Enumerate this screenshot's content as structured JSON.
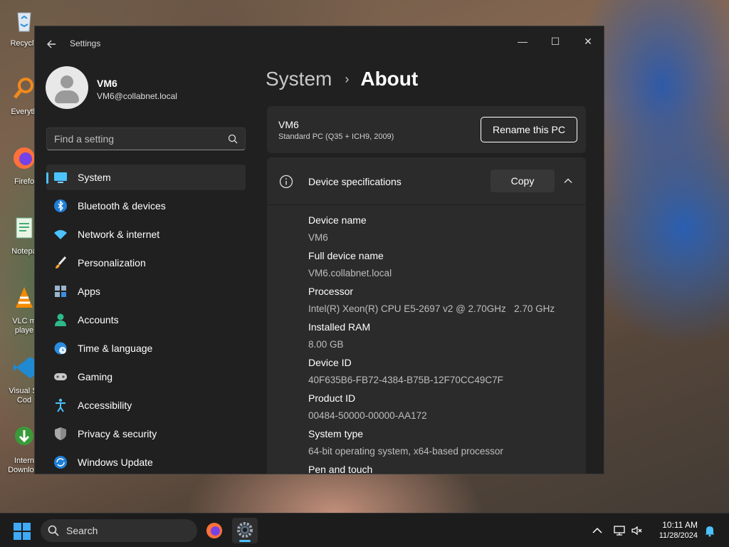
{
  "desktop": {
    "icons": [
      {
        "label": "Recycle",
        "icon": "recycle-bin-icon"
      },
      {
        "label": "Everyth",
        "icon": "everything-search-icon"
      },
      {
        "label": "Firefo",
        "icon": "firefox-icon"
      },
      {
        "label": "Notepa",
        "icon": "notepad-icon"
      },
      {
        "label": "VLC m\nplaye",
        "icon": "vlc-icon"
      },
      {
        "label": "Visual St\nCod",
        "icon": "vscode-icon"
      },
      {
        "label": "Intern\nDownlo...",
        "icon": "internet-download-manager-icon"
      }
    ]
  },
  "window": {
    "title": "Settings",
    "controls": {
      "minimize": "—",
      "maximize": "☐",
      "close": "✕"
    }
  },
  "user": {
    "name": "VM6",
    "email": "VM6@collabnet.local"
  },
  "search": {
    "placeholder": "Find a setting"
  },
  "sidebar": {
    "items": [
      {
        "label": "System",
        "icon": "system-icon",
        "selected": true
      },
      {
        "label": "Bluetooth & devices",
        "icon": "bluetooth-icon"
      },
      {
        "label": "Network & internet",
        "icon": "wifi-icon"
      },
      {
        "label": "Personalization",
        "icon": "brush-icon"
      },
      {
        "label": "Apps",
        "icon": "apps-icon"
      },
      {
        "label": "Accounts",
        "icon": "accounts-icon"
      },
      {
        "label": "Time & language",
        "icon": "globe-clock-icon"
      },
      {
        "label": "Gaming",
        "icon": "gamepad-icon"
      },
      {
        "label": "Accessibility",
        "icon": "accessibility-icon"
      },
      {
        "label": "Privacy & security",
        "icon": "shield-icon"
      },
      {
        "label": "Windows Update",
        "icon": "update-icon"
      }
    ]
  },
  "main": {
    "breadcrumb": {
      "parent": "System",
      "separator": "›",
      "current": "About"
    },
    "pc_card": {
      "name": "VM6",
      "model": "Standard PC (Q35 + ICH9, 2009)",
      "rename_label": "Rename this PC"
    },
    "device_specs": {
      "title": "Device specifications",
      "copy_label": "Copy",
      "items": [
        {
          "label": "Device name",
          "value": "VM6"
        },
        {
          "label": "Full device name",
          "value": "VM6.collabnet.local"
        },
        {
          "label": "Processor",
          "value": "Intel(R) Xeon(R) CPU E5-2697 v2 @ 2.70GHz   2.70 GHz"
        },
        {
          "label": "Installed RAM",
          "value": "8.00 GB"
        },
        {
          "label": "Device ID",
          "value": "40F635B6-FB72-4384-B75B-12F70CC49C7F"
        },
        {
          "label": "Product ID",
          "value": "00484-50000-00000-AA172"
        },
        {
          "label": "System type",
          "value": "64-bit operating system, x64-based processor"
        },
        {
          "label": "Pen and touch",
          "value": ""
        }
      ]
    }
  },
  "taskbar": {
    "search_label": "Search",
    "time": "10:11 AM",
    "date": "11/28/2024"
  },
  "colors": {
    "accent": "#4cc2ff",
    "window_bg": "#202020",
    "card_bg": "#2b2b2b"
  }
}
